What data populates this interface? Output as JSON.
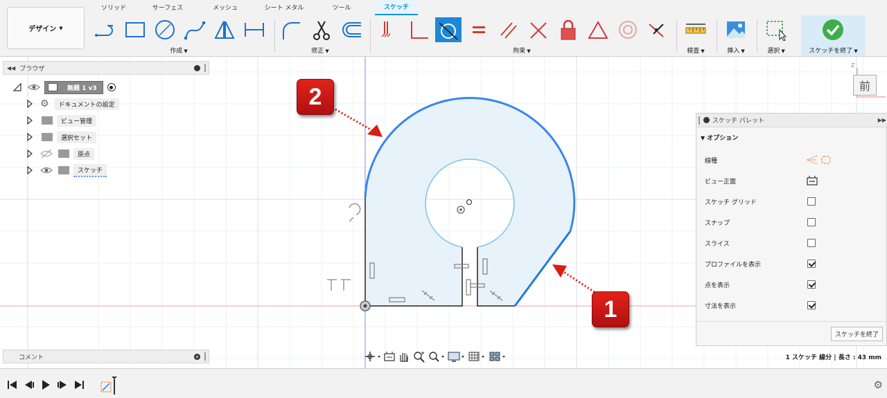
{
  "workspace": {
    "label": "デザイン"
  },
  "tabs": [
    "ソリッド",
    "サーフェス",
    "メッシュ",
    "シート メタル",
    "ツール",
    "スケッチ"
  ],
  "groups": {
    "create": "作成",
    "modify": "修正",
    "constraints": "拘束",
    "inspect": "検査",
    "insert": "挿入",
    "select": "選択",
    "finish": "スケッチを終了"
  },
  "browser": {
    "title": "ブラウザ",
    "root": "無題 1 v3",
    "items": [
      "ドキュメントの設定",
      "ビュー管理",
      "選択セット",
      "原点",
      "スケッチ"
    ]
  },
  "palette": {
    "title": "スケッチ パレット",
    "section": "オプション",
    "rows": [
      {
        "label": "線種",
        "type": "icons"
      },
      {
        "label": "ビュー正面",
        "type": "icon"
      },
      {
        "label": "スケッチ グリッド",
        "type": "check",
        "checked": false
      },
      {
        "label": "スナップ",
        "type": "check",
        "checked": false
      },
      {
        "label": "スライス",
        "type": "check",
        "checked": false
      },
      {
        "label": "プロファイルを表示",
        "type": "check",
        "checked": true
      },
      {
        "label": "点を表示",
        "type": "check",
        "checked": true
      },
      {
        "label": "寸法を表示",
        "type": "check",
        "checked": true
      }
    ],
    "finish_button": "スケッチを終了"
  },
  "comments": {
    "title": "コメント"
  },
  "status": {
    "text": "1 スケッチ 線分 | 長さ : 43 mm"
  },
  "viewcube": {
    "face": "前",
    "axis": "Z"
  },
  "callouts": [
    "1",
    "2"
  ],
  "colors": {
    "accent": "#0696d7",
    "selected": "#2f7de1",
    "callout": "#d91c14",
    "profile_fill": "#e8f2fb"
  }
}
